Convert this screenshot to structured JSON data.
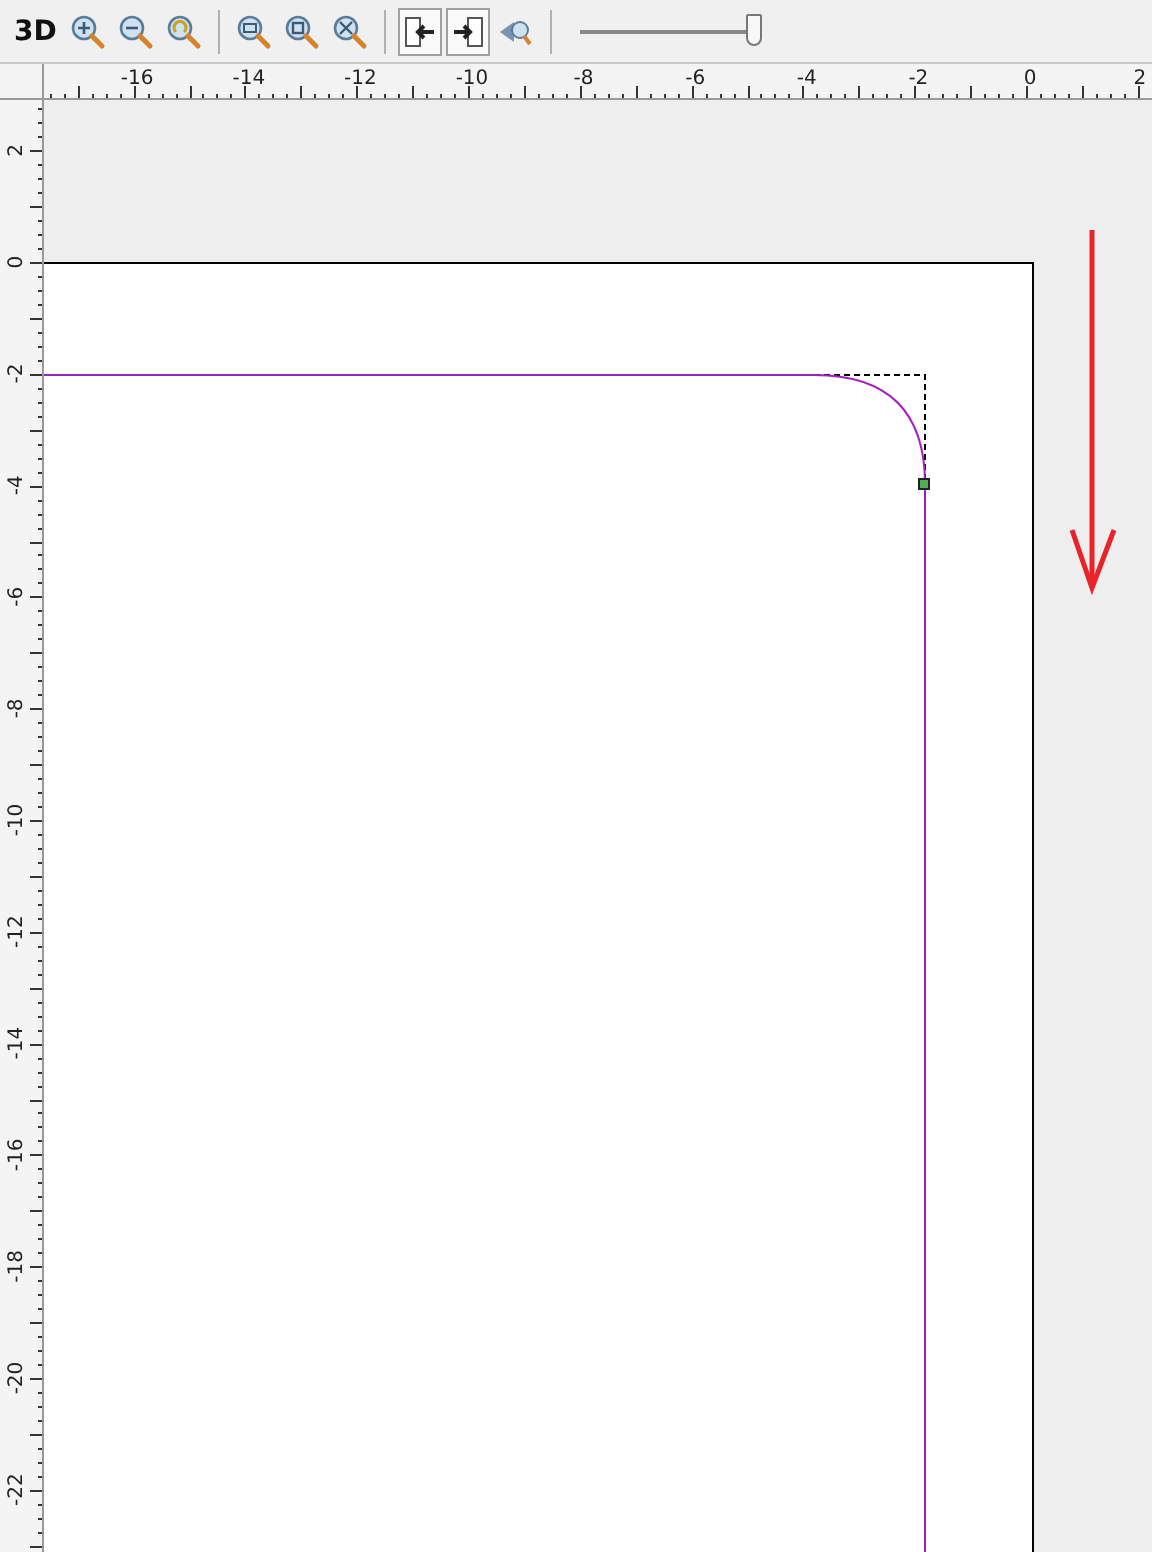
{
  "toolbar": {
    "view_label": "3D",
    "toggles": [
      {
        "selected": true
      },
      {
        "selected": true
      },
      {
        "selected": false
      }
    ],
    "zoom_slider": {
      "level": 0.96
    }
  },
  "horizontal_ruler": {
    "labels": [
      "-16",
      "-14",
      "-12",
      "-10",
      "-8",
      "-6",
      "-4",
      "-2",
      "0",
      "2"
    ]
  },
  "vertical_ruler": {
    "labels": [
      "2",
      "0",
      "-2",
      "-4",
      "-6",
      "-8",
      "-10",
      "-12",
      "-14",
      "-16",
      "-18",
      "-20",
      "-22"
    ]
  }
}
